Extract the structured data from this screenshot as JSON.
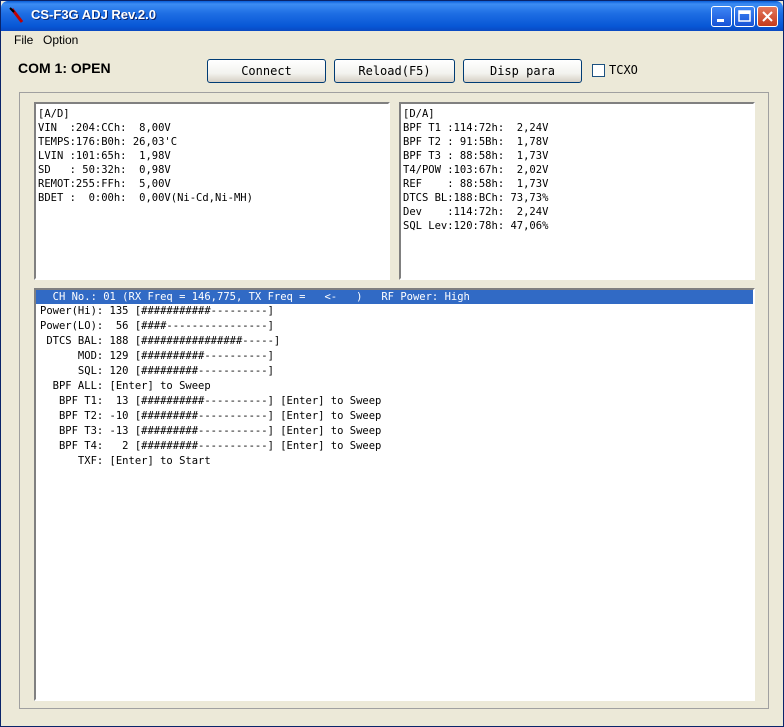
{
  "window": {
    "title": "CS-F3G ADJ Rev.2.0"
  },
  "menu": {
    "file": "File",
    "option": "Option"
  },
  "status": {
    "com": "COM 1: OPEN"
  },
  "toolbar": {
    "connect": "Connect",
    "reload": "Reload(F5)",
    "disp_para": "Disp para",
    "tcxo_label": "TCXO",
    "tcxo_checked": false
  },
  "ad_panel": {
    "lines": [
      "[A/D]",
      "VIN  :204:CCh:  8,00V",
      "TEMPS:176:B0h: 26,03'C",
      "LVIN :101:65h:  1,98V",
      "SD   : 50:32h:  0,98V",
      "REMOT:255:FFh:  5,00V",
      "BDET :  0:00h:  0,00V(Ni-Cd,Ni-MH)"
    ]
  },
  "da_panel": {
    "lines": [
      "[D/A]",
      "BPF T1 :114:72h:  2,24V",
      "BPF T2 : 91:5Bh:  1,78V",
      "BPF T3 : 88:58h:  1,73V",
      "T4/POW :103:67h:  2,02V",
      "REF    : 88:58h:  1,73V",
      "DTCS BL:188:BCh: 73,73%",
      "Dev    :114:72h:  2,24V",
      "SQL Lev:120:78h: 47,06%"
    ]
  },
  "channel_panel": {
    "header": "  CH No.: 01 (RX Freq = 146,775, TX Freq =   <-   )   RF Power: High",
    "rows": [
      "Power(Hi): 135 [###########---------]",
      "Power(LO):  56 [####----------------]",
      " DTCS BAL: 188 [################-----]",
      "      MOD: 129 [##########----------]",
      "      SQL: 120 [#########-----------]",
      "  BPF ALL: [Enter] to Sweep",
      "   BPF T1:  13 [##########----------] [Enter] to Sweep",
      "   BPF T2: -10 [#########-----------] [Enter] to Sweep",
      "   BPF T3: -13 [#########-----------] [Enter] to Sweep",
      "   BPF T4:   2 [#########-----------] [Enter] to Sweep",
      "      TXF: [Enter] to Start"
    ]
  }
}
